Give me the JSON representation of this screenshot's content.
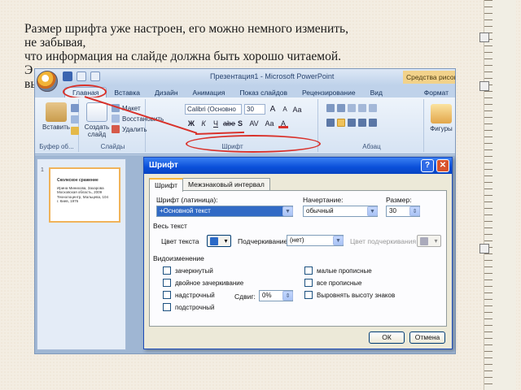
{
  "slide": {
    "lines": [
      "Размер шрифта уже настроен, его можно немного изменить,",
      "не забывая,",
      "что информация на слайде должна быть хорошо читаемой.",
      "Э",
      "вы"
    ]
  },
  "app": {
    "title": "Презентация1 - Microsoft PowerPoint",
    "context_tab": "Средства рисова",
    "tabs": [
      "Главная",
      "Вставка",
      "Дизайн",
      "Анимация",
      "Показ слайдов",
      "Рецензирование",
      "Вид"
    ],
    "tab_right": "Формат",
    "active_tab": "Главная"
  },
  "ribbon": {
    "clipboard": {
      "paste_label": "Вставить",
      "group_label": "Буфер об..."
    },
    "slides": {
      "new_slide_label": "Создать слайд",
      "layout_label": "Макет",
      "reset_label": "Восстановить",
      "delete_label": "Удалить",
      "group_label": "Слайды"
    },
    "font": {
      "font_name": "Calibri (Основно",
      "font_size": "30",
      "bold": "Ж",
      "italic": "К",
      "underline": "Ч",
      "strike": "abe",
      "shadow": "S",
      "spacing": "AV",
      "case": "Aa",
      "color": "A",
      "grow": "A",
      "shrink": "A",
      "clear": "Aa",
      "group_label": "Шрифт"
    },
    "paragraph": {
      "group_label": "Абзац"
    },
    "drawing": {
      "label": "Фигуры"
    }
  },
  "thumbnail": {
    "number": "1",
    "title": "Сколкское сражение",
    "lines": [
      "Ирина Минихова, Захарова",
      "Московская область, 2009",
      "Технолоцентр, Мальцева, 104",
      "г. Киев, 1976"
    ]
  },
  "font_dialog": {
    "title": "Шрифт",
    "tabs": [
      "Шрифт",
      "Межзнаковый интервал"
    ],
    "latin_font_label": "Шрифт (латиница):",
    "latin_font_value": "+Основной текст",
    "style_label": "Начертание:",
    "style_value": "обычный",
    "size_label": "Размер:",
    "size_value": "30",
    "all_text_label": "Весь текст",
    "color_label": "Цвет текста",
    "underline_label": "Подчеркивание",
    "underline_value": "(нет)",
    "underline_color_label": "Цвет подчеркивания",
    "effects_label": "Видоизменение",
    "effects_left": [
      "зачеркнутый",
      "двойное зачеркивание",
      "надстрочный",
      "подстрочный"
    ],
    "effects_right": [
      "малые прописные",
      "все прописные",
      "Выровнять высоту знаков"
    ],
    "offset_label": "Сдвиг:",
    "offset_value": "0%",
    "ok_label": "ОК",
    "cancel_label": "Отмена"
  },
  "colors": {
    "accent_red": "#d9322b",
    "xp_title_blue": "#0a4fd9",
    "ribbon_blue": "#d6e3f3"
  }
}
